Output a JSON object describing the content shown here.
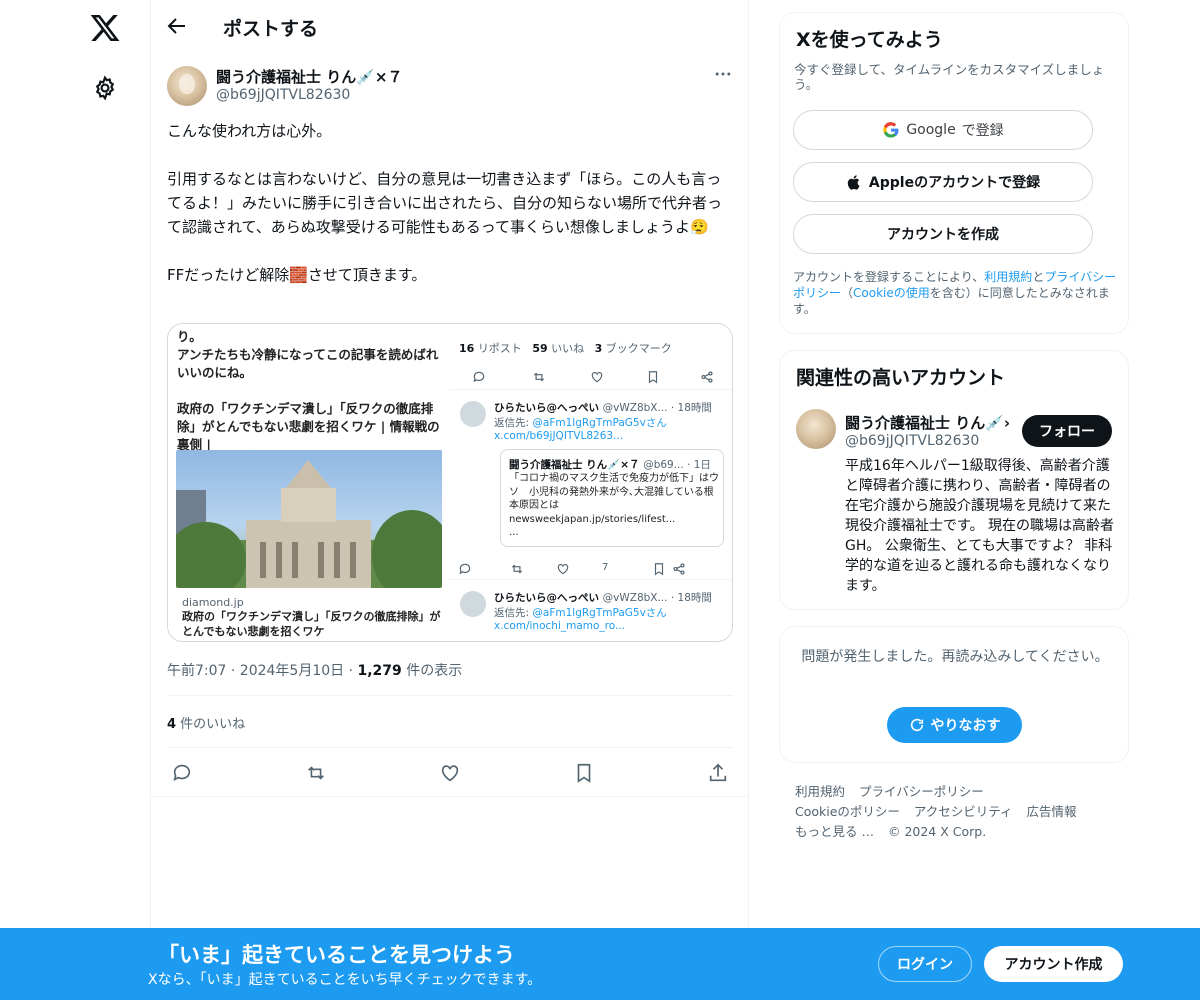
{
  "icons": {
    "logo": "x-logo-icon",
    "settings": "gear-icon",
    "back": "arrow-left-icon",
    "more": "more-horizontal-icon",
    "reply": "reply-icon",
    "retweet": "retweet-icon",
    "like": "heart-icon",
    "bookmark": "bookmark-icon",
    "share": "share-icon",
    "google": "google-icon",
    "apple": "apple-icon",
    "refresh": "refresh-icon"
  },
  "colors": {
    "accent": "#1d9bf0",
    "text": "#0f1419",
    "muted": "#536471",
    "border": "#eff3f4"
  },
  "header": {
    "title": "ポストする"
  },
  "post": {
    "author_name": "闘う介護福祉士 りん💉×７",
    "author_handle": "@b69jJQITVL82630",
    "text_lines": [
      "こんな使われ方は心外。",
      "",
      "引用するなとは言わないけど、自分の意見は一切書き込まず「ほら。この人も言ってるよ！」みたいに勝手に引き合いに出されたら、自分の知らない場所で代弁者って認識されて、あらぬ攻撃受ける可能性もあるって事くらい想像しましょうよ😮‍💨",
      "",
      "FFだったけど解除🧱させて頂きます。"
    ],
    "media": {
      "left_text": "り。\nアンチたちも冷静になってこの記事を読めばれいいのにね。\n\n政府の「ワクチンデマ潰し」「反ワクの徹底排除」がとんでもない悲劇を招くワケ | 情報戦の裏側 |",
      "source": "diamond.jp",
      "caption": "政府の「ワクチンデマ潰し」「反ワクの徹底排除」がとんでもない悲劇を招くワケ",
      "stats": {
        "reposts": "16",
        "reposts_label": "リポスト",
        "likes": "59",
        "likes_label": "いいね",
        "bookmarks": "3",
        "bookmarks_label": "ブックマーク"
      },
      "reply1": {
        "name": "ひらたいら@へっぺい",
        "meta": "@vWZ8bX... · 18時間",
        "to_label": "返信先: ",
        "to": "@aFm1lgRgTmPaG5vさん",
        "link": "x.com/b69jJQITVL8263..."
      },
      "quote": {
        "name": "闘う介護福祉士 りん💉×７",
        "meta": "@b69... · 1日",
        "text": "「コロナ禍のマスク生活で免疫力が低下」はウソ　小児科の発熱外来が今､大混雑している根本原因とは newsweekjapan.jp/stories/lifest...\n..."
      },
      "reply2": {
        "name": "ひらたいら@へっぺい",
        "meta": "@vWZ8bX... · 18時間",
        "to_label": "返信先: ",
        "to": "@aFm1lgRgTmPaG5vさん",
        "link": "x.com/inochi_mamo_ro..."
      },
      "views_mini": "7"
    },
    "time": "午前7:07 · 2024年5月10日 · ",
    "views": "1,279",
    "views_label": " 件の表示",
    "likes": "4",
    "likes_label": " 件のいいね"
  },
  "signup_card": {
    "title": "Xを使ってみよう",
    "subtitle": "今すぐ登録して、タイムラインをカスタマイズしましょう。",
    "google_brand": "Google",
    "google_label": "で登録",
    "apple_label": "Appleのアカウントで登録",
    "create_label": "アカウントを作成",
    "legal_prefix": "アカウントを登録することにより、",
    "legal_terms": "利用規約",
    "legal_and": "と",
    "legal_privacy": "プライバシーポリシー",
    "legal_mid": "（",
    "legal_cookie": "Cookieの使用",
    "legal_suffix": "を含む）に同意したとみなされます。"
  },
  "related": {
    "title": "関連性の高いアカウント",
    "name": "闘う介護福祉士 りん💉›",
    "handle": "@b69jJQITVL82630",
    "follow_label": "フォロー",
    "bio": "平成16年ヘルパー1級取得後、高齢者介護と障碍者介護に携わり、高齢者・障碍者の在宅介護から施設介護現場を見続けて来た現役介護福祉士です。 現在の職場は高齢者GH。 公衆衛生、とても大事ですよ？ 非科学的な道を辿ると護れる命も護れなくなります。"
  },
  "error_card": {
    "message": "問題が発生しました。再読み込みしてください。",
    "retry_label": "やりなおす"
  },
  "footer": {
    "links": [
      "利用規約",
      "プライバシーポリシー",
      "Cookieのポリシー",
      "アクセシビリティ",
      "広告情報",
      "もっと見る …"
    ],
    "copyright": "© 2024 X Corp."
  },
  "banner": {
    "title": "「いま」起きていることを見つけよう",
    "subtitle": "Xなら、「いま」起きていることをいち早くチェックできます。",
    "login_label": "ログイン",
    "signup_label": "アカウント作成"
  }
}
